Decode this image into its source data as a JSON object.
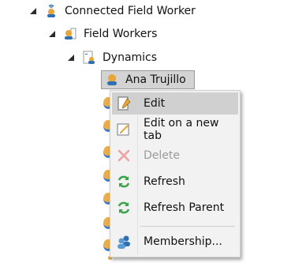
{
  "tree": {
    "root": {
      "label": "Connected Field Worker"
    },
    "child": {
      "label": "Field Workers"
    },
    "grandchild": {
      "label": "Dynamics"
    },
    "selected": {
      "label": "Ana Trujillo"
    }
  },
  "context_menu": {
    "items": [
      {
        "label": "Edit",
        "icon": "document-pencil-icon",
        "state": "hover"
      },
      {
        "label": "Edit on a new tab",
        "icon": "edit-new-tab-icon",
        "state": "enabled"
      },
      {
        "label": "Delete",
        "icon": "red-x-icon",
        "state": "disabled"
      },
      {
        "label": "Refresh",
        "icon": "green-refresh-icon",
        "state": "enabled"
      },
      {
        "label": "Refresh Parent",
        "icon": "green-refresh-icon",
        "state": "enabled"
      },
      {
        "label": "Membership...",
        "icon": "users-icon",
        "state": "enabled"
      }
    ]
  },
  "colors": {
    "selection_bg": "#d3d3d3",
    "menu_bg": "#f2f2f2",
    "menu_hover": "#d0d0d0",
    "disabled_text": "#9a9a9a",
    "user_orange": "#e7a53a",
    "user_blue": "#2f6fb4"
  }
}
